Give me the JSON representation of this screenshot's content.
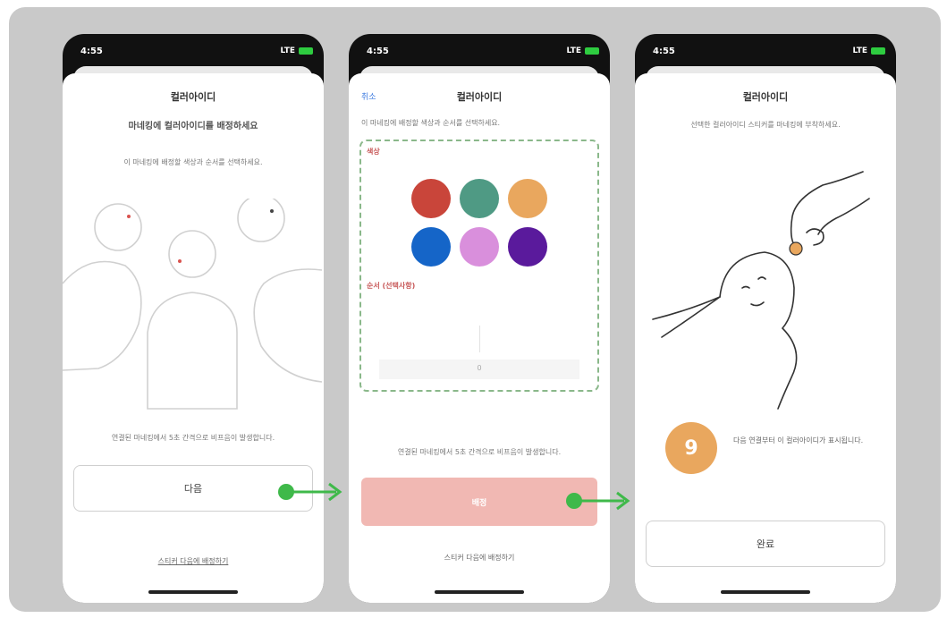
{
  "screens": [
    {
      "status_time": "4:55",
      "status_signal": "LTE",
      "title": "컬러아이디",
      "headline": "마네킹에 컬러아이디를 배정하세요",
      "instruction": "이 마네킹에 배정할 색상과 순서를 선택하세요.",
      "notice": "연결된 마네킹에서 5초 간격으로 비프음이 발생합니다.",
      "next_button": "다음",
      "sticker_link": "스티커 다음에 배정하기"
    },
    {
      "status_time": "4:55",
      "status_signal": "LTE",
      "back_label": "취소",
      "title": "컬러아이디",
      "instruction": "이 마네킹에 배정할 색상과 순서를 선택하세요.",
      "color_label": "색상",
      "colors": [
        "#c9453a",
        "#4f9a84",
        "#e9a75e",
        "#1565c8",
        "#d98fdc",
        "#5a1a9c"
      ],
      "order_label": "순서 (선택사항)",
      "order_hint": "0",
      "notice": "연결된 마네킹에서 5초 간격으로 비프음이 발생합니다.",
      "confirm_button": "배정",
      "sticker_link": "스티커 다음에 배정하기"
    },
    {
      "status_time": "4:55",
      "status_signal": "LTE",
      "title": "컬러아이디",
      "instruction": "선택한 컬러아이디 스티커를 마네킹에 부착하세요.",
      "count_value": "9",
      "count_text": "다음 연결부터 이 컬러아이디가 표시됩니다.",
      "done_button": "완료"
    }
  ],
  "colors": {
    "arrow": "#3fb94a",
    "board": "#c9c9c9",
    "confirm_fill": "#f1b8b3",
    "count_circle": "#e9a75e"
  }
}
